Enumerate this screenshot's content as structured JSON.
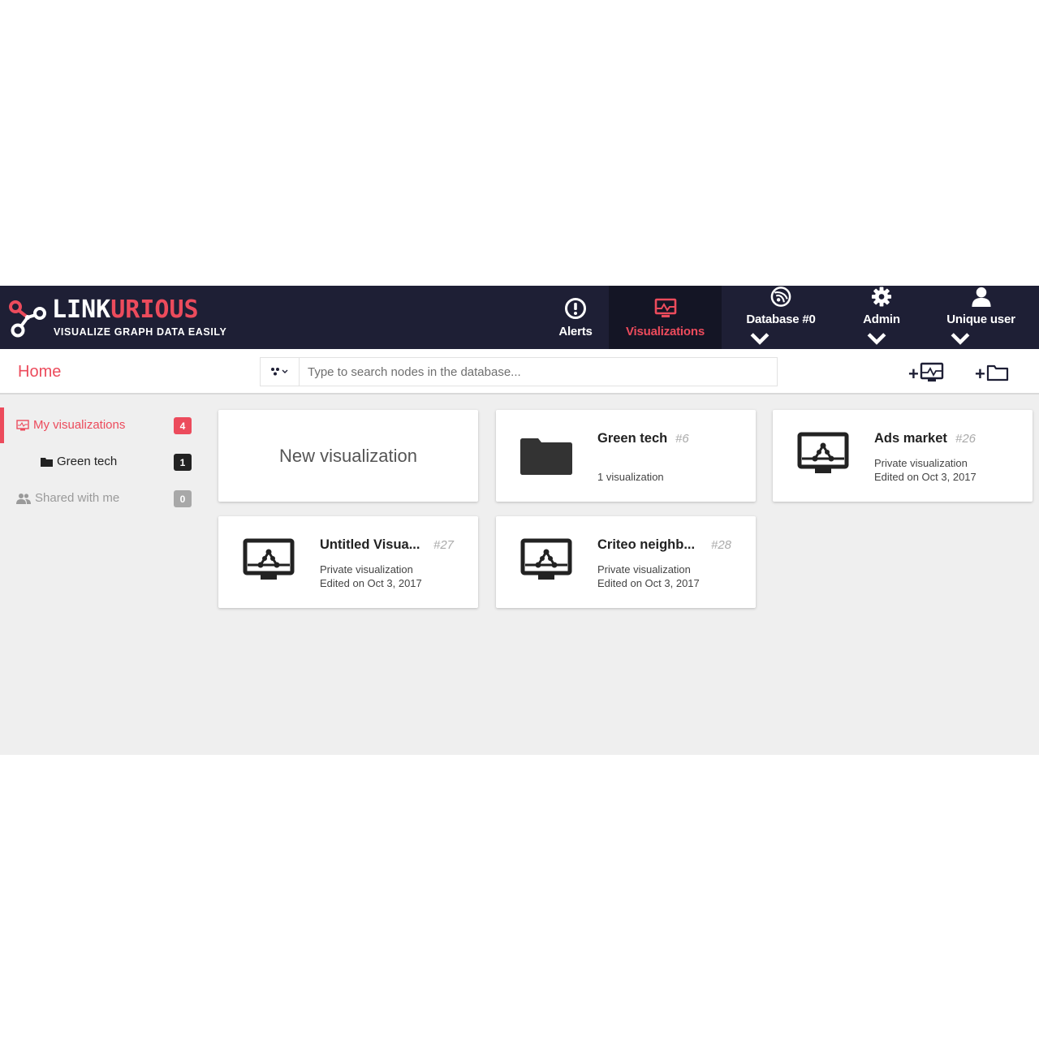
{
  "brand": {
    "name_part1": "LINK",
    "name_part2": "URIOUS",
    "tagline": "VISUALIZE GRAPH DATA EASILY"
  },
  "nav": {
    "alerts": "Alerts",
    "visualizations": "Visualizations",
    "database": "Database #0",
    "admin": "Admin",
    "user": "Unique user"
  },
  "subheader": {
    "home": "Home",
    "search_placeholder": "Type to search nodes in the database..."
  },
  "sidebar": {
    "items": [
      {
        "label": "My visualizations",
        "count": "4"
      },
      {
        "label": "Green tech",
        "count": "1"
      },
      {
        "label": "Shared with me",
        "count": "0"
      }
    ]
  },
  "cards": {
    "new": "New visualization",
    "items": [
      {
        "title": "Green tech",
        "id": "#6",
        "line1": "1 visualization",
        "line2": ""
      },
      {
        "title": "Ads market",
        "id": "#26",
        "line1": "Private visualization",
        "line2": "Edited on Oct 3, 2017"
      },
      {
        "title": "Untitled Visua...",
        "id": "#27",
        "line1": "Private visualization",
        "line2": "Edited on Oct 3, 2017"
      },
      {
        "title": "Criteo neighb...",
        "id": "#28",
        "line1": "Private visualization",
        "line2": "Edited on Oct 3, 2017"
      }
    ]
  },
  "icons": {
    "logo": "linkurious-logo-icon",
    "alerts": "exclamation-circle-icon",
    "visualizations": "monitor-graph-icon",
    "database": "database-globe-icon",
    "admin": "gear-icon",
    "user": "user-icon",
    "search_type": "node-filter-icon",
    "add_visualization": "add-visualization-icon",
    "add_folder": "add-folder-icon",
    "folder": "folder-icon",
    "shared": "users-icon"
  },
  "colors": {
    "navbar": "#1e1f35",
    "accent": "#ec4b5c",
    "background": "#efefef",
    "badge_dark": "#222222",
    "badge_muted": "#a8a8a8"
  }
}
